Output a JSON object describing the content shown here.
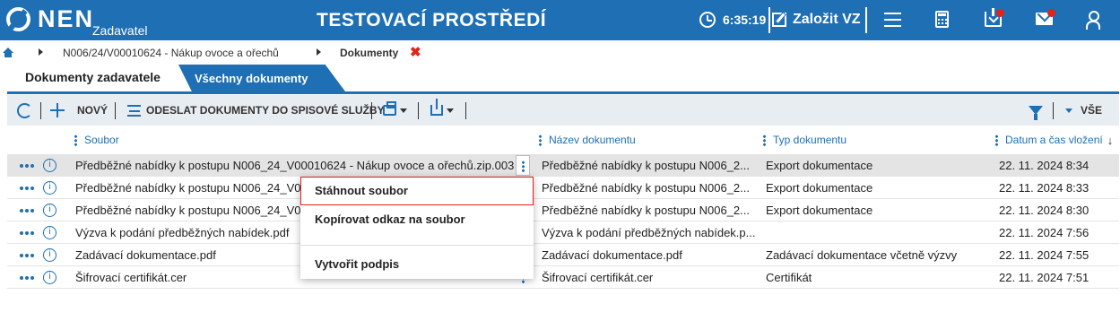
{
  "header": {
    "logo": "NEN",
    "role": "Zadavatel",
    "environment": "TESTOVACÍ PROSTŘEDÍ",
    "clock": "6:35:19",
    "create_label": "Založit VZ",
    "notification_color": "#e2231a",
    "brand_color": "#1e6fb3",
    "icons": [
      "clock-icon",
      "edit-icon",
      "hamburger-icon",
      "calculator-icon",
      "inbox-icon",
      "mail-icon",
      "user-icon"
    ]
  },
  "breadcrumb": {
    "items": [
      "N006/24/V00010624 - Nákup ovoce a ořechů",
      "Dokumenty"
    ],
    "close": "✖"
  },
  "tabs": [
    {
      "label": "Dokumenty zadavatele",
      "active": true
    },
    {
      "label": "Všechny dokumenty",
      "active": false
    }
  ],
  "toolbar": {
    "new_label": "NOVÝ",
    "send_label": "ODESLAT DOKUMENTY DO SPISOVÉ SLUŽBY",
    "filter_scope": "VŠE"
  },
  "table": {
    "columns": [
      "Soubor",
      "Název dokumentu",
      "Typ dokumentu",
      "Datum a čas vložení"
    ],
    "sort_indicator": "↓",
    "info_glyph": "i",
    "rows": [
      {
        "file": "Předběžné nabídky k postupu N006_24_V00010624 - Nákup ovoce a ořechů.zip.003",
        "name": "Předběžné nabídky k postupu N006_2...",
        "type": "Export dokumentace",
        "date": "22. 11. 2024 8:34"
      },
      {
        "file": "Předběžné nabídky k postupu N006_24_V00010624 - Nákup ovoce a ořechů.zip.002",
        "name": "Předběžné nabídky k postupu N006_2...",
        "type": "Export dokumentace",
        "date": "22. 11. 2024 8:33"
      },
      {
        "file": "Předběžné nabídky k postupu N006_24_V00010624 - Nákup ovoce a ořechů.zip.001",
        "name": "Předběžné nabídky k postupu N006_2...",
        "type": "Export dokumentace",
        "date": "22. 11. 2024 8:30"
      },
      {
        "file": "Výzva k podání předběžných nabídek.pdf",
        "name": "Výzva k podání předběžných nabídek.p...",
        "type": "",
        "date": "22. 11. 2024 7:56"
      },
      {
        "file": "Zadávací dokumentace.pdf",
        "name": "Zadávací dokumentace.pdf",
        "type": "Zadávací dokumentace včetně výzvy",
        "date": "22. 11. 2024 7:55"
      },
      {
        "file": "Šifrovací certifikát.cer",
        "name": "Šifrovací certifikát.cer",
        "type": "Certifikát",
        "date": "22. 11. 2024 7:51"
      }
    ]
  },
  "context_menu": {
    "items": [
      "Stáhnout soubor",
      "Kopírovat odkaz na soubor",
      "Vytvořit podpis"
    ]
  }
}
